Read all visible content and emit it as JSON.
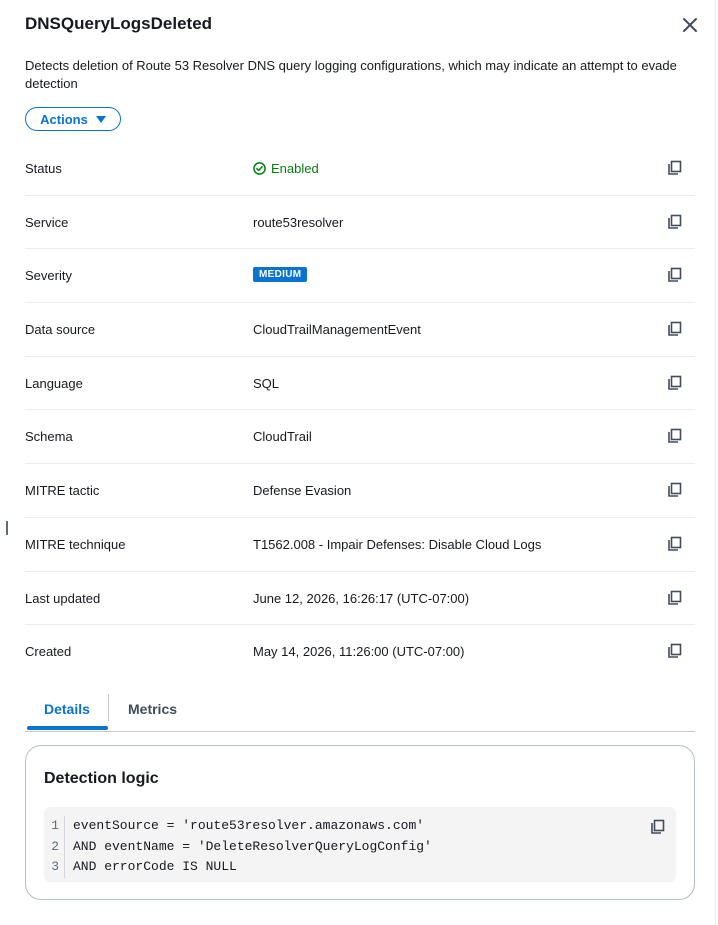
{
  "panel": {
    "title": "DNSQueryLogsDeleted",
    "description": "Detects deletion of Route 53 Resolver DNS query logging configurations, which may indicate an attempt to evade detection",
    "actions_label": "Actions"
  },
  "details": {
    "status": {
      "label": "Status",
      "value": "Enabled"
    },
    "service": {
      "label": "Service",
      "value": "route53resolver"
    },
    "severity": {
      "label": "Severity",
      "value": "MEDIUM"
    },
    "data_source": {
      "label": "Data source",
      "value": "CloudTrailManagementEvent"
    },
    "language": {
      "label": "Language",
      "value": "SQL"
    },
    "schema": {
      "label": "Schema",
      "value": "CloudTrail"
    },
    "mitre_tactic": {
      "label": "MITRE tactic",
      "value": "Defense Evasion"
    },
    "mitre_technique": {
      "label": "MITRE technique",
      "value": "T1562.008 - Impair Defenses: Disable Cloud Logs"
    },
    "last_updated": {
      "label": "Last updated",
      "value": "June 12, 2026, 16:26:17 (UTC-07:00)"
    },
    "created": {
      "label": "Created",
      "value": "May 14, 2026, 11:26:00 (UTC-07:00)"
    }
  },
  "tabs": [
    {
      "label": "Details",
      "selected": true
    },
    {
      "label": "Metrics",
      "selected": false
    }
  ],
  "detection_logic": {
    "title": "Detection logic",
    "lines": [
      {
        "n": "1",
        "code": "eventSource = 'route53resolver.amazonaws.com'"
      },
      {
        "n": "2",
        "code": "AND eventName = 'DeleteResolverQueryLogConfig'"
      },
      {
        "n": "3",
        "code": "AND errorCode IS NULL"
      }
    ]
  },
  "colors": {
    "accent": "#0972d3",
    "success": "#037f0c",
    "text": "#16191f"
  },
  "icons": [
    "close-icon",
    "check-circle-icon",
    "copy-icon",
    "caret-down-icon"
  ]
}
